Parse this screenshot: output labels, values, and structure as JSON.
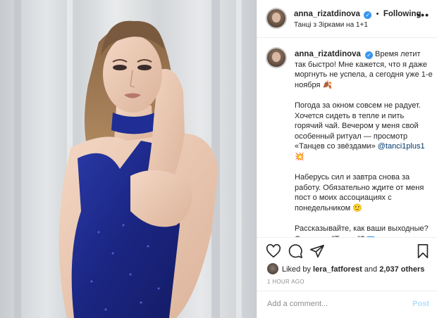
{
  "post": {
    "author": "anna_rizatdinova",
    "header_separator": "•",
    "follow_status": "Following",
    "location": "Танці з Зірками на 1+1",
    "more_label": "•••",
    "verified_icon": "✓"
  },
  "caption": {
    "author": "anna_rizatdinova",
    "p1": "Время летит так быстро! Мне кажется, что я даже моргнуть не успела, а сегодня уже 1-е ноября 🍂",
    "p2_before": "Погода за окном совсем не радует. Хочется сидеть в тепле и пить горячий чай. Вечером у меня свой особенный ритуал — просмотр «Танцев со звёздами» ",
    "p2_mention": "@tanci1plus1",
    "p2_after": " 💥",
    "p3": "Наберусь сил и завтра снова за работу. Обязательно ждите от меня пост о моих ассоциациях с понедельником 🙂",
    "p4": "Рассказывайте, как ваши выходные? Смотрите \"Танцы\"? ",
    "p4_icon": "i"
  },
  "engagement": {
    "liked_by_prefix": "Liked by ",
    "liked_by_user": "lera_fatforest",
    "and_text": " and ",
    "others": "2,037 others",
    "timestamp": "1 HOUR AGO"
  },
  "comment": {
    "placeholder": "Add a comment...",
    "post_label": "Post"
  },
  "icons": [
    "heart-icon",
    "comment-icon",
    "share-icon",
    "bookmark-icon",
    "more-icon",
    "verified-icon"
  ],
  "colors": {
    "dress": "#1e2b8f",
    "verified": "#3897f0",
    "post_disabled": "#b2dffc",
    "link": "#00376b"
  }
}
